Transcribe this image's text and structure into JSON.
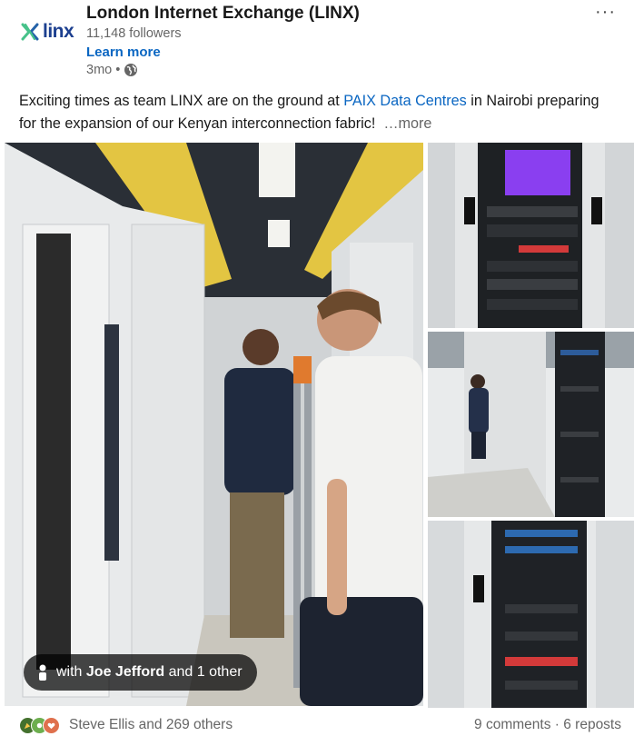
{
  "post": {
    "org_name": "London Internet Exchange (LINX)",
    "logo_text": "linx",
    "followers": "11,148 followers",
    "learn_more": "Learn more",
    "time_ago": "3mo",
    "separator": "•",
    "more_menu": "···",
    "text_before": "Exciting times as team LINX are on the ground at ",
    "mention": "PAIX Data Centres",
    "text_after": " in Nairobi preparing for the expansion of our Kenyan interconnection fabric!",
    "see_more": "…more",
    "tag": {
      "prefix": "with ",
      "name": "Joe Jefford",
      "suffix": " and 1 other"
    },
    "reactors": "Steve Ellis and 269 others",
    "comments": "9 comments",
    "reposts": "6 reposts",
    "dot": " · ",
    "colors": {
      "brand": "#1c3f8f",
      "link": "#0a66c2",
      "muted": "#666666",
      "logo_green": "#47c28a",
      "logo_blue": "#2563a8"
    },
    "icons": [
      "linx-logo-icon",
      "globe-icon",
      "more-icon",
      "person-icon",
      "celebrate-reaction-icon",
      "support-reaction-icon",
      "love-reaction-icon"
    ]
  }
}
